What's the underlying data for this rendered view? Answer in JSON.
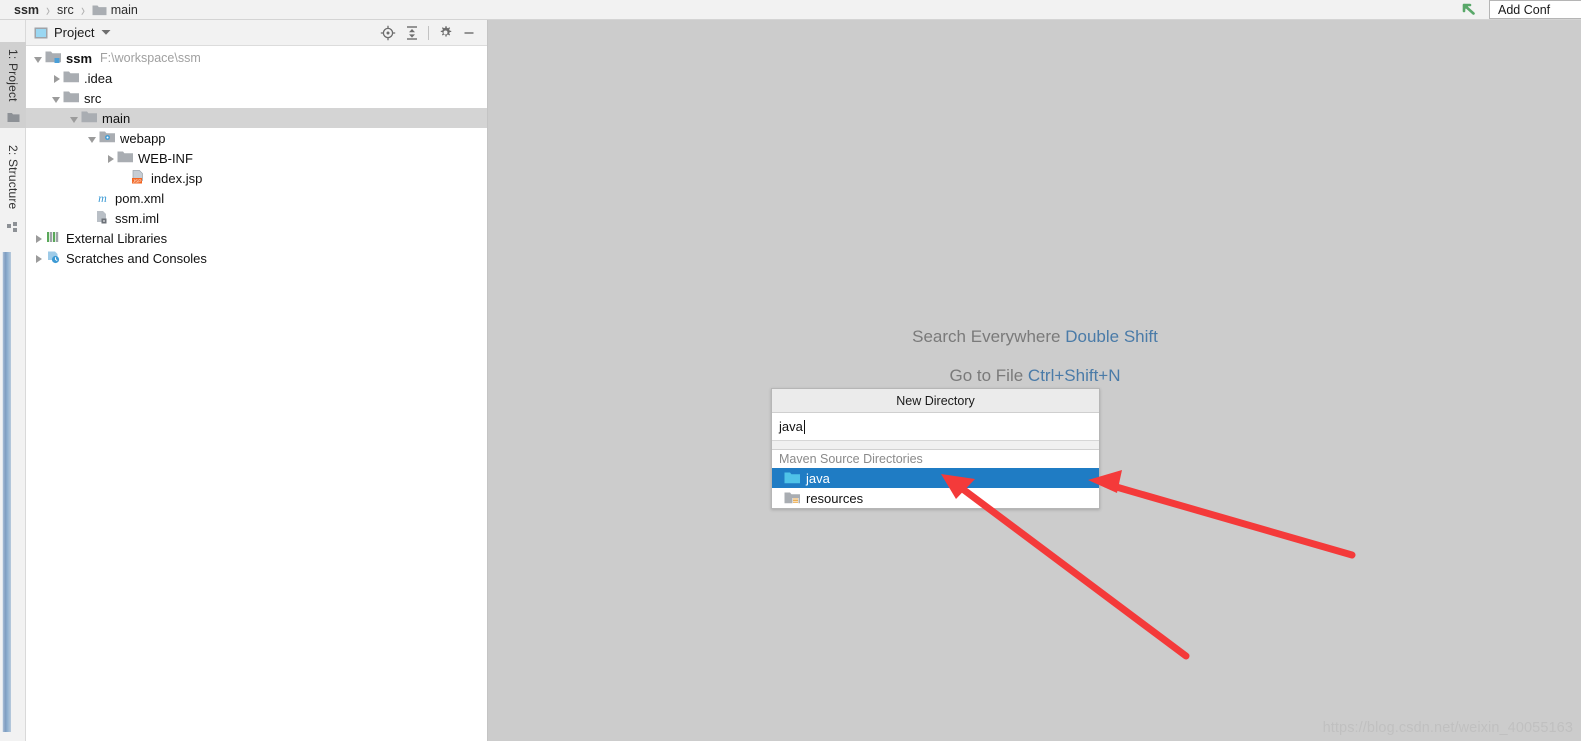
{
  "breadcrumb": {
    "items": [
      {
        "label": "ssm",
        "bold": true,
        "icon": "none"
      },
      {
        "label": "src",
        "bold": false,
        "icon": "none"
      },
      {
        "label": "main",
        "bold": false,
        "icon": "folder-icon"
      }
    ],
    "separator": "›"
  },
  "topbar": {
    "run_icon": "run-arrow-icon",
    "add_config_label": "Add Conf"
  },
  "tool_tabs": [
    {
      "label": "1: Project",
      "icon": "project-folder-icon",
      "active": true
    },
    {
      "label": "2: Structure",
      "icon": "structure-icon",
      "active": false
    }
  ],
  "project_panel": {
    "title": "Project",
    "title_icon": "project-view-icon",
    "dropdown_icon": "chevron-down-icon",
    "tools": [
      {
        "name": "locate-icon",
        "title": "Select Opened File"
      },
      {
        "name": "collapse-all-icon",
        "title": "Collapse All"
      },
      {
        "name": "gear-icon",
        "title": "Settings"
      },
      {
        "name": "minimize-icon",
        "title": "Hide"
      }
    ],
    "tree": [
      {
        "label": "ssm",
        "path": "F:\\workspace\\ssm",
        "depth": 0,
        "twist": "open",
        "icon": "module-folder-icon",
        "bold": true,
        "selected": false
      },
      {
        "label": ".idea",
        "path": "",
        "depth": 1,
        "twist": "closed",
        "icon": "folder-icon",
        "bold": false,
        "selected": false
      },
      {
        "label": "src",
        "path": "",
        "depth": 1,
        "twist": "open",
        "icon": "folder-icon",
        "bold": false,
        "selected": false
      },
      {
        "label": "main",
        "path": "",
        "depth": 2,
        "twist": "open",
        "icon": "folder-icon",
        "bold": false,
        "selected": true
      },
      {
        "label": "webapp",
        "path": "",
        "depth": 3,
        "twist": "open",
        "icon": "webapp-folder-icon",
        "bold": false,
        "selected": false
      },
      {
        "label": "WEB-INF",
        "path": "",
        "depth": 4,
        "twist": "closed",
        "icon": "folder-icon",
        "bold": false,
        "selected": false
      },
      {
        "label": "index.jsp",
        "path": "",
        "depth": 4,
        "twist": "none",
        "icon": "jsp-file-icon",
        "bold": false,
        "selected": false
      },
      {
        "label": "pom.xml",
        "path": "",
        "depth": 2,
        "twist": "none",
        "icon": "maven-pom-icon",
        "bold": false,
        "selected": false
      },
      {
        "label": "ssm.iml",
        "path": "",
        "depth": 2,
        "twist": "none",
        "icon": "iml-file-icon",
        "bold": false,
        "selected": false
      },
      {
        "label": "External Libraries",
        "path": "",
        "depth": 0,
        "twist": "closed",
        "icon": "libraries-icon",
        "bold": false,
        "selected": false
      },
      {
        "label": "Scratches and Consoles",
        "path": "",
        "depth": 0,
        "twist": "closed",
        "icon": "scratches-icon",
        "bold": false,
        "selected": false
      }
    ]
  },
  "editor_hints": [
    {
      "action": "Search Everywhere",
      "shortcut": "Double Shift"
    },
    {
      "action": "Go to File",
      "shortcut": "Ctrl+Shift+N"
    }
  ],
  "new_directory_popup": {
    "title": "New Directory",
    "input_value": "java",
    "group_label": "Maven Source Directories",
    "items": [
      {
        "label": "java",
        "icon": "source-folder-icon",
        "selected": true
      },
      {
        "label": "resources",
        "icon": "resources-folder-icon",
        "selected": false
      }
    ]
  },
  "annotations": {
    "arrow_color": "#f43a3a",
    "count": 2
  },
  "watermark": "https://blog.csdn.net/weixin_40055163",
  "colors": {
    "selection_blue": "#1f7cc4",
    "tree_selection_gray": "#d4d4d4",
    "editor_background": "#cccccc",
    "hint_key": "#4a7ba8",
    "arrow_red": "#f43a3a"
  }
}
